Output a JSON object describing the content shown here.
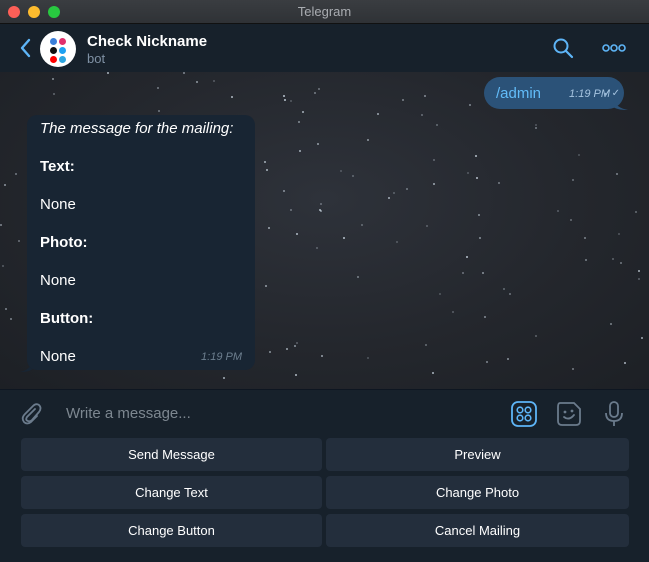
{
  "window": {
    "title": "Telegram"
  },
  "chat": {
    "name": "Check Nickname",
    "status": "bot"
  },
  "messages": {
    "outgoing": {
      "text": "/admin",
      "time": "1:19 PM",
      "read_mark": "✓✓"
    },
    "incoming": {
      "lines": [
        {
          "text": "The message for the mailing:",
          "style": "italic"
        },
        {
          "text": "Text:",
          "style": "bold"
        },
        {
          "text": "None",
          "style": "normal"
        },
        {
          "text": "Photo:",
          "style": "bold"
        },
        {
          "text": "None",
          "style": "normal"
        },
        {
          "text": "Button:",
          "style": "bold"
        },
        {
          "text": "None",
          "style": "normal"
        }
      ],
      "time": "1:19 PM"
    }
  },
  "composer": {
    "placeholder": "Write a message..."
  },
  "bot_keyboard": {
    "rows": [
      [
        "Send Message",
        "Preview"
      ],
      [
        "Change Text",
        "Change Photo"
      ],
      [
        "Change Button",
        "Cancel Mailing"
      ]
    ]
  },
  "colors": {
    "accent": "#5eb5f7",
    "outgoing_bubble": "#2b5278",
    "incoming_bubble": "#182533",
    "panel": "#17212b",
    "button": "#232e3c"
  },
  "icons": {
    "back": "chevron-left-icon",
    "search": "search-icon",
    "more": "more-icon",
    "attach": "paperclip-icon",
    "bot_keyboard": "bot-keyboard-icon",
    "sticker": "sticker-icon",
    "mic": "microphone-icon"
  }
}
